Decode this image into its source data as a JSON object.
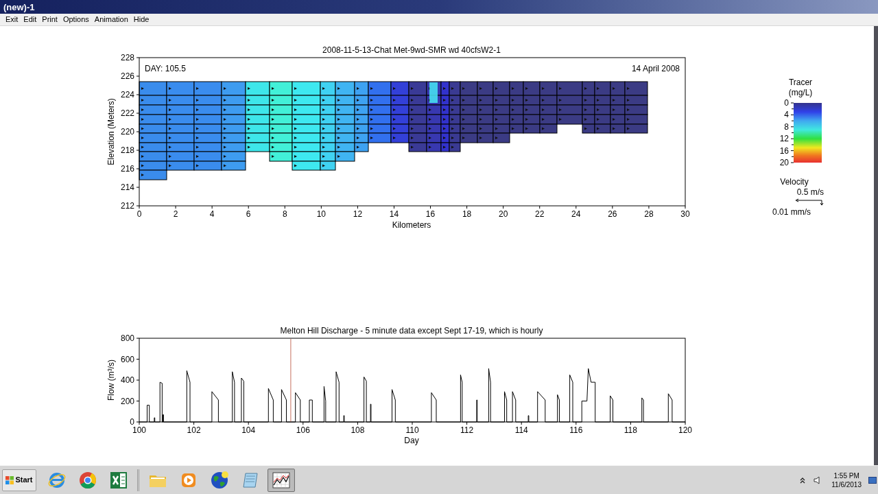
{
  "window": {
    "title": "(new)-1"
  },
  "menu": [
    "Exit",
    "Edit",
    "Print",
    "Options",
    "Animation",
    "Hide"
  ],
  "profile_plot": {
    "title": "2008-11-5-13-Chat Met-9wd-SMR wd 40cfsW2-1",
    "day_label": "DAY: 105.5",
    "date_label": "14 April 2008",
    "xlabel": "Kilometers",
    "ylabel": "Elevation (Meters)",
    "xticks": [
      "0",
      "2",
      "4",
      "6",
      "8",
      "10",
      "12",
      "14",
      "16",
      "18",
      "20",
      "22",
      "24",
      "26",
      "28",
      "30"
    ],
    "yticks": [
      "228",
      "226",
      "224",
      "222",
      "220",
      "218",
      "216",
      "214",
      "212"
    ]
  },
  "legend": {
    "tracer_title": "Tracer",
    "tracer_units": "(mg/L)",
    "scale_ticks": [
      "0",
      "4",
      "8",
      "12",
      "16",
      "20"
    ],
    "velocity_title": "Velocity",
    "velocity_horizontal_scale": "0.5 m/s",
    "velocity_vertical_scale": "0.01 mm/s"
  },
  "discharge_plot": {
    "chart_data": {
      "type": "line",
      "title": "Melton Hill Discharge - 5 minute data except Sept 17-19, which is hourly",
      "xlabel": "Day",
      "ylabel": "Flow (m³/s)",
      "x": [
        100,
        100.29,
        100.29,
        100.37,
        100.37,
        100.55,
        100.55,
        100.57,
        100.57,
        100.76,
        100.76,
        100.84,
        100.84,
        100.87,
        100.87,
        100.89,
        100.89,
        101.74,
        101.74,
        101.86,
        101.86,
        102.66,
        102.66,
        102.9,
        102.9,
        103.41,
        103.41,
        103.49,
        103.49,
        103.74,
        103.74,
        103.83,
        103.83,
        104.73,
        104.73,
        104.91,
        104.91,
        105.21,
        105.21,
        105.39,
        105.39,
        105.72,
        105.72,
        105.9,
        105.9,
        106.23,
        106.23,
        106.34,
        106.34,
        106.77,
        106.77,
        106.83,
        106.83,
        107.21,
        107.21,
        107.32,
        107.32,
        107.49,
        107.49,
        107.51,
        107.51,
        108.23,
        108.23,
        108.32,
        108.32,
        108.47,
        108.47,
        108.49,
        108.49,
        109.26,
        109.26,
        109.38,
        109.38,
        110.7,
        110.7,
        110.88,
        110.88,
        111.77,
        111.77,
        111.83,
        111.83,
        112.36,
        112.36,
        112.38,
        112.38,
        112.8,
        112.8,
        112.87,
        112.87,
        113.38,
        113.38,
        113.46,
        113.46,
        113.67,
        113.67,
        113.79,
        113.79,
        114.25,
        114.25,
        114.27,
        114.27,
        114.59,
        114.59,
        114.87,
        114.87,
        115.32,
        115.32,
        115.39,
        115.39,
        115.77,
        115.77,
        115.88,
        115.88,
        116.21,
        116.21,
        116.4,
        116.45,
        116.55,
        116.7,
        116.7,
        117.25,
        117.25,
        117.35,
        117.35,
        118.41,
        118.41,
        118.47,
        118.47,
        119.38,
        119.38,
        119.52,
        119.52,
        120
      ],
      "series": [
        {
          "color": "#000000",
          "values": [
            0,
            0,
            160,
            160,
            0,
            0,
            40,
            40,
            0,
            0,
            380,
            370,
            0,
            0,
            70,
            70,
            0,
            0,
            490,
            380,
            0,
            0,
            290,
            210,
            0,
            0,
            480,
            380,
            0,
            0,
            420,
            390,
            0,
            0,
            320,
            210,
            0,
            0,
            310,
            210,
            0,
            0,
            280,
            210,
            0,
            0,
            210,
            210,
            0,
            0,
            340,
            200,
            0,
            0,
            480,
            380,
            0,
            0,
            60,
            60,
            0,
            0,
            430,
            390,
            0,
            0,
            170,
            170,
            0,
            0,
            310,
            210,
            0,
            0,
            280,
            210,
            0,
            0,
            450,
            380,
            0,
            0,
            210,
            210,
            0,
            0,
            510,
            380,
            0,
            0,
            290,
            210,
            0,
            0,
            290,
            210,
            0,
            0,
            60,
            60,
            0,
            0,
            290,
            210,
            0,
            0,
            260,
            210,
            0,
            0,
            450,
            380,
            0,
            0,
            200,
            200,
            510,
            380,
            380,
            0,
            0,
            250,
            210,
            0,
            0,
            230,
            210,
            0,
            0,
            270,
            210,
            0,
            0
          ]
        }
      ],
      "xlim": [
        100,
        120
      ],
      "ylim": [
        0,
        800
      ],
      "xticks": [
        100,
        102,
        104,
        106,
        108,
        110,
        112,
        114,
        116,
        118,
        120
      ],
      "yticks": [
        0,
        200,
        400,
        600,
        800
      ],
      "ref_lines": [
        {
          "axis": "x",
          "value": 105.55,
          "color": "#d08878"
        }
      ]
    }
  },
  "taskbar": {
    "start": "Start",
    "apps": [
      {
        "kind": "ie",
        "active": false
      },
      {
        "kind": "chrome",
        "active": false
      },
      {
        "kind": "excel",
        "active": false
      },
      {
        "kind": "folder",
        "active": false
      },
      {
        "kind": "media",
        "active": false
      },
      {
        "kind": "globe",
        "active": false
      },
      {
        "kind": "notepad",
        "active": false
      },
      {
        "kind": "chart",
        "active": true
      }
    ],
    "clock_time": "1:55 PM",
    "clock_date": "11/6/2013"
  }
}
